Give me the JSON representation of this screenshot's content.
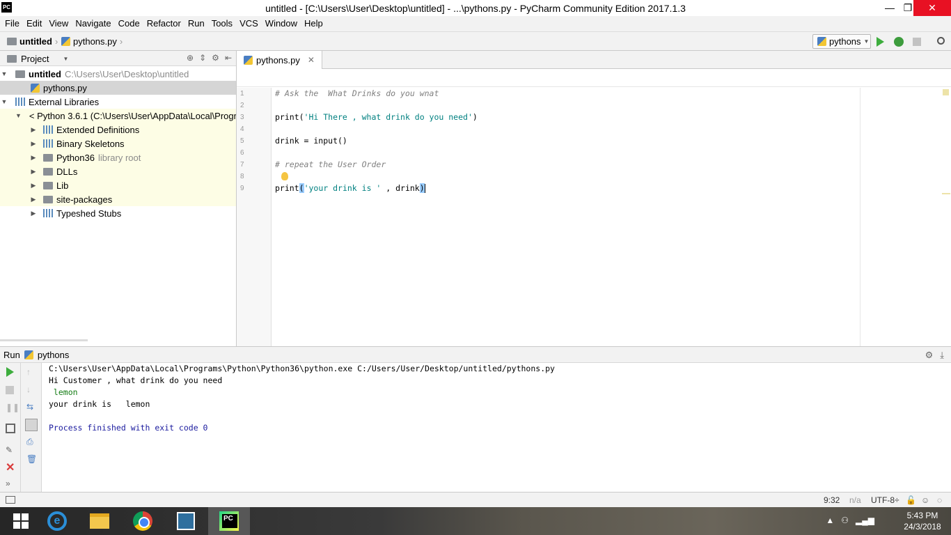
{
  "window": {
    "logo_text": "PC",
    "title": "untitled - [C:\\Users\\User\\Desktop\\untitled] - ...\\pythons.py - PyCharm Community Edition 2017.1.3",
    "minimize": "—",
    "maximize": "❐",
    "close": "✕"
  },
  "menu": [
    "File",
    "Edit",
    "View",
    "Navigate",
    "Code",
    "Refactor",
    "Run",
    "Tools",
    "VCS",
    "Window",
    "Help"
  ],
  "navbar": {
    "project": "untitled",
    "file": "pythons.py",
    "run_config": "pythons"
  },
  "project_panel": {
    "title": "Project",
    "tree": [
      {
        "label": "untitled",
        "extra": "C:\\Users\\User\\Desktop\\untitled"
      },
      {
        "label": "pythons.py"
      },
      {
        "label": "External Libraries"
      },
      {
        "label": "< Python 3.6.1 (C:\\Users\\User\\AppData\\Local\\Progra"
      },
      {
        "label": "Extended Definitions"
      },
      {
        "label": "Binary Skeletons"
      },
      {
        "label": "Python36",
        "extra": "library root"
      },
      {
        "label": "DLLs"
      },
      {
        "label": "Lib"
      },
      {
        "label": "site-packages"
      },
      {
        "label": "Typeshed Stubs"
      }
    ]
  },
  "editor": {
    "tab_label": "pythons.py",
    "line_numbers": [
      "1",
      "2",
      "3",
      "4",
      "5",
      "6",
      "7",
      "8",
      "9"
    ],
    "code": {
      "l1": "# Ask the  What Drinks do you wnat",
      "l3_fn": "print(",
      "l3_str": "'Hi There , what drink do you need'",
      "l3_end": ")",
      "l5": "drink = input()",
      "l7": "# repeat the User Order",
      "l9_fn": "print",
      "l9_open": "(",
      "l9_str": "'your drink is '",
      "l9_rest": " , drink",
      "l9_close": ")"
    }
  },
  "run_panel": {
    "label": "Run",
    "config": "pythons",
    "console": {
      "command": "C:\\Users\\User\\AppData\\Local\\Programs\\Python\\Python36\\python.exe C:/Users/User/Desktop/untitled/pythons.py",
      "out1": "Hi Customer , what drink do you need",
      "input": " lemon",
      "out2": "your drink is   lemon",
      "exit": "Process finished with exit code 0"
    }
  },
  "statusbar": {
    "position": "9:32",
    "line_sep": "n/a",
    "encoding": "UTF-8÷"
  },
  "taskbar": {
    "time": "5:43 PM",
    "date": "24/3/2018"
  },
  "colors": {
    "run_green": "#3dad3d",
    "close_red": "#e81123",
    "string_teal": "#008080",
    "comment_gray": "#808080",
    "library_bg": "#fdfde5"
  }
}
